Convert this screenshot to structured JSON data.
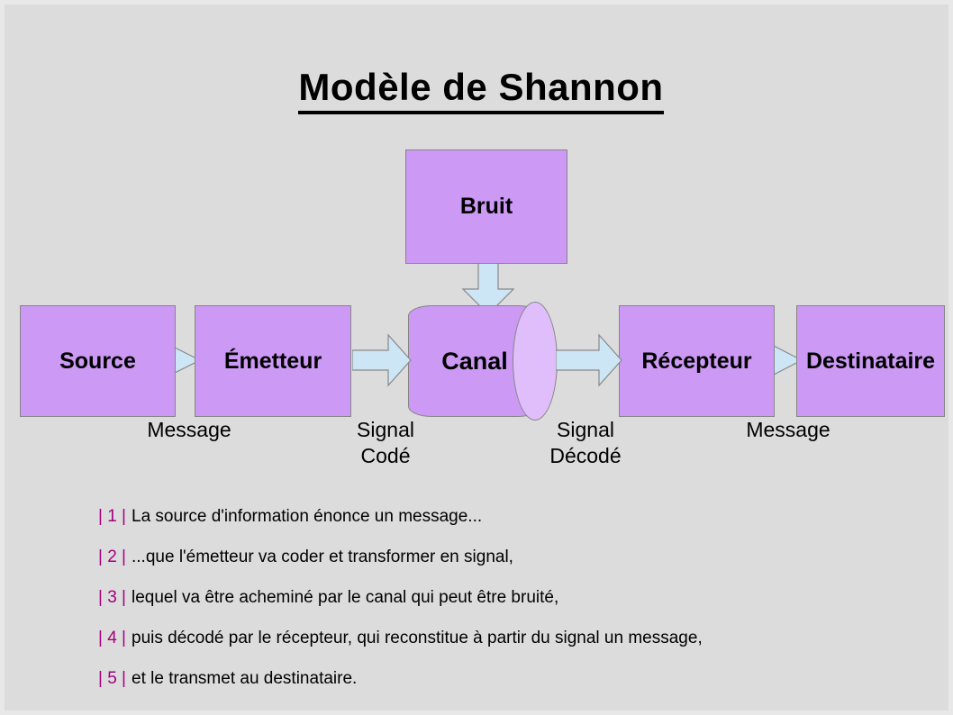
{
  "slide": {
    "title": "Modèle de Shannon",
    "background_color": "#dcdcdc",
    "node_fill_color": "#cc99f5",
    "arrow_fill_color": "#cce6f5",
    "marker_color": "#a3007f"
  },
  "nodes": {
    "bruit": "Bruit",
    "source": "Source",
    "emetteur": "Émetteur",
    "canal": "Canal",
    "recepteur": "Récepteur",
    "destinataire": "Destinataire"
  },
  "flow_labels": {
    "message_1": "Message",
    "signal_code_line1": "Signal",
    "signal_code_line2": "Codé",
    "signal_decode_line1": "Signal",
    "signal_decode_line2": "Décodé",
    "message_2": "Message"
  },
  "steps": [
    {
      "marker": "| 1 |",
      "text": "La source d'information énonce un message..."
    },
    {
      "marker": "| 2 |",
      "text": "...que l'émetteur va coder et transformer en signal,"
    },
    {
      "marker": "| 3 |",
      "text": "lequel va être acheminé par le canal qui peut être bruité,"
    },
    {
      "marker": "| 4 |",
      "text": "puis décodé par le récepteur, qui reconstitue à partir du signal un message,"
    },
    {
      "marker": "| 5 |",
      "text": "et le transmet au destinataire."
    }
  ]
}
